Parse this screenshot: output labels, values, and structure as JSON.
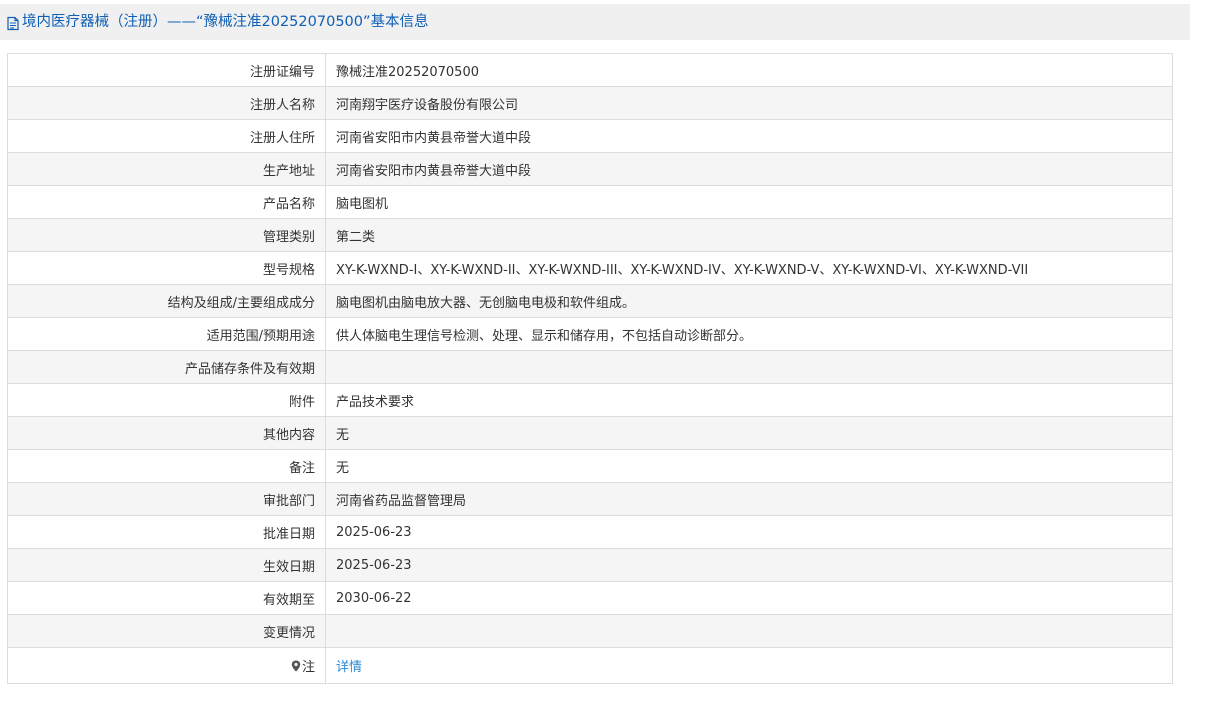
{
  "header": {
    "title": "境内医疗器械（注册）——“豫械注准20252070500”基本信息",
    "icon": "document-icon",
    "color": "#0f5fb5"
  },
  "rows": [
    {
      "label": "注册证编号",
      "value": "豫械注准20252070500"
    },
    {
      "label": "注册人名称",
      "value": "河南翔宇医疗设备股份有限公司"
    },
    {
      "label": "注册人住所",
      "value": "河南省安阳市内黄县帝誉大道中段"
    },
    {
      "label": "生产地址",
      "value": "河南省安阳市内黄县帝誉大道中段"
    },
    {
      "label": "产品名称",
      "value": "脑电图机"
    },
    {
      "label": "管理类别",
      "value": "第二类"
    },
    {
      "label": "型号规格",
      "value": "XY-K-WXND-I、XY-K-WXND-II、XY-K-WXND-III、XY-K-WXND-IV、XY-K-WXND-V、XY-K-WXND-VI、XY-K-WXND-VII"
    },
    {
      "label": "结构及组成/主要组成成分",
      "value": "脑电图机由脑电放大器、无创脑电电极和软件组成。"
    },
    {
      "label": "适用范围/预期用途",
      "value": "供人体脑电生理信号检测、处理、显示和储存用，不包括自动诊断部分。"
    },
    {
      "label": "产品储存条件及有效期",
      "value": ""
    },
    {
      "label": "附件",
      "value": "产品技术要求"
    },
    {
      "label": "其他内容",
      "value": "无"
    },
    {
      "label": "备注",
      "value": "无"
    },
    {
      "label": "审批部门",
      "value": "河南省药品监督管理局"
    },
    {
      "label": "批准日期",
      "value": "2025-06-23"
    },
    {
      "label": "生效日期",
      "value": "2025-06-23"
    },
    {
      "label": "有效期至",
      "value": "2030-06-22"
    },
    {
      "label": "变更情况",
      "value": ""
    }
  ],
  "note_row": {
    "label": "注",
    "icon": "pin-icon",
    "link_text": "详情",
    "link_color": "#2a8ad6"
  }
}
